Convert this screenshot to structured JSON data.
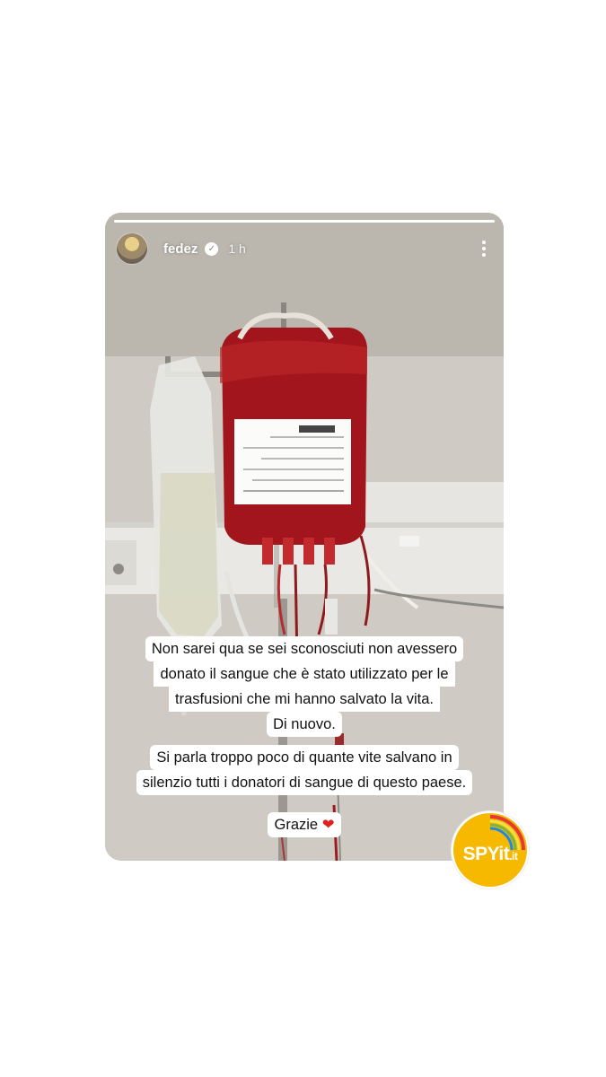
{
  "story": {
    "progress": 1.0,
    "username": "fedez",
    "time": "1 h",
    "verified_icon": "✓",
    "photo_description_icon": "blood-bag-photo"
  },
  "captions": {
    "line1": "Non sarei qua se sei sconosciuti non avessero",
    "line2": "donato il sangue che è stato utilizzato per le",
    "line3": "trasfusioni che mi hanno salvato la vita.",
    "line4": "Di nuovo.",
    "line5": "Si parla troppo poco di quante vite salvano in",
    "line6": "silenzio tutti i donatori di sangue di questo paese.",
    "grazie": "Grazie",
    "heart": "❤"
  },
  "watermark": {
    "brand": "SPYit",
    "tld": ".it"
  },
  "colors": {
    "heart": "#e0201d",
    "watermark": "#f7b800",
    "blood": "#a3151c"
  }
}
